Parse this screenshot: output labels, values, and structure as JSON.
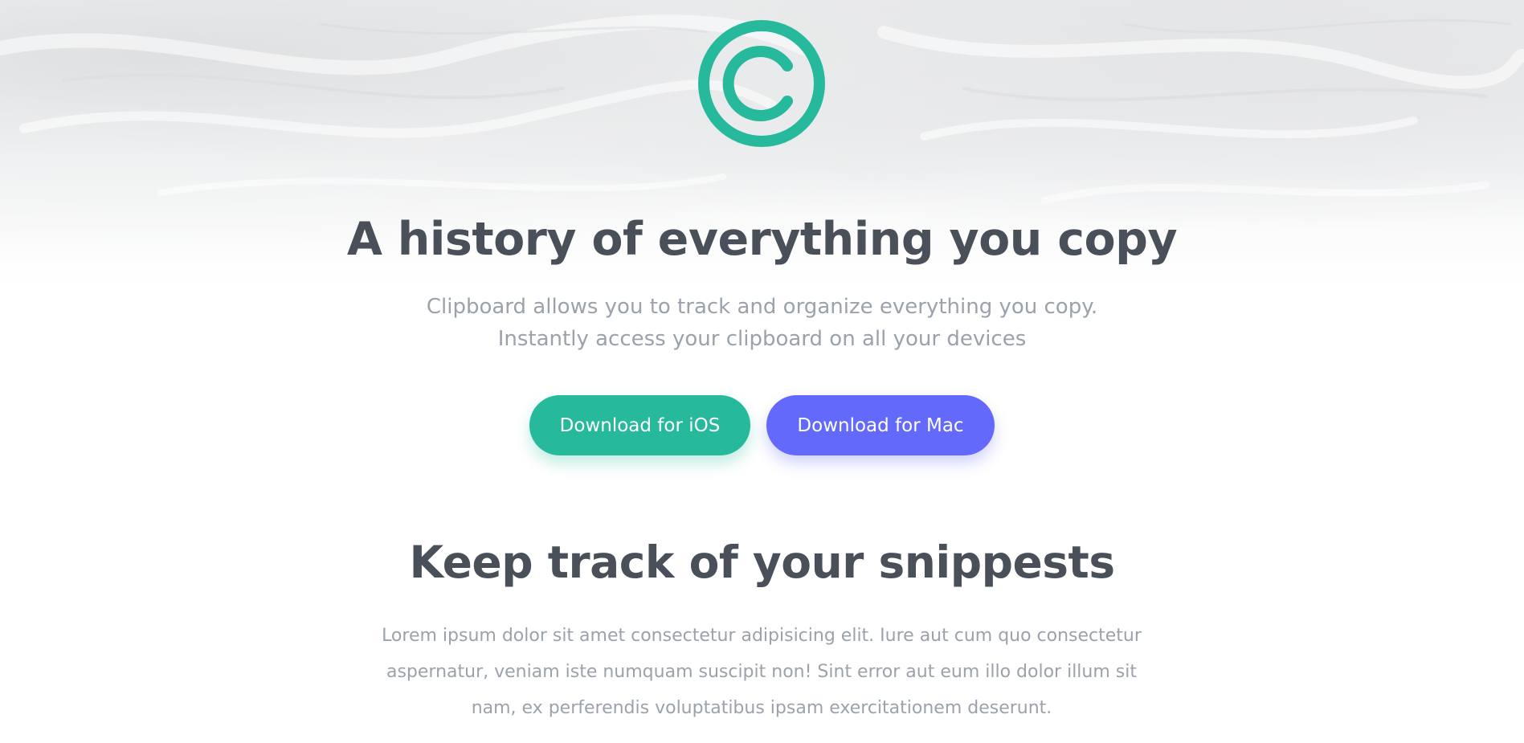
{
  "hero": {
    "logo_icon": "copyright-c-icon",
    "headline": "A history of everything you copy",
    "subline_1": "Clipboard allows you to track and organize everything you copy.",
    "subline_2": "Instantly access your clipboard on all your devices"
  },
  "buttons": {
    "ios_label": "Download for iOS",
    "mac_label": "Download for Mac"
  },
  "section": {
    "title": "Keep track of your snippests",
    "body": "Lorem ipsum dolor sit amet consectetur adipisicing elit. Iure aut cum quo consectetur aspernatur, veniam iste numquam suscipit non! Sint error aut eum illo dolor illum sit nam, ex perferendis voluptatibus ipsam exercitationem deserunt."
  },
  "colors": {
    "accent_teal": "#26b99c",
    "accent_indigo": "#6269fb",
    "heading": "#4a5059",
    "muted_text": "#9ba2ab"
  }
}
